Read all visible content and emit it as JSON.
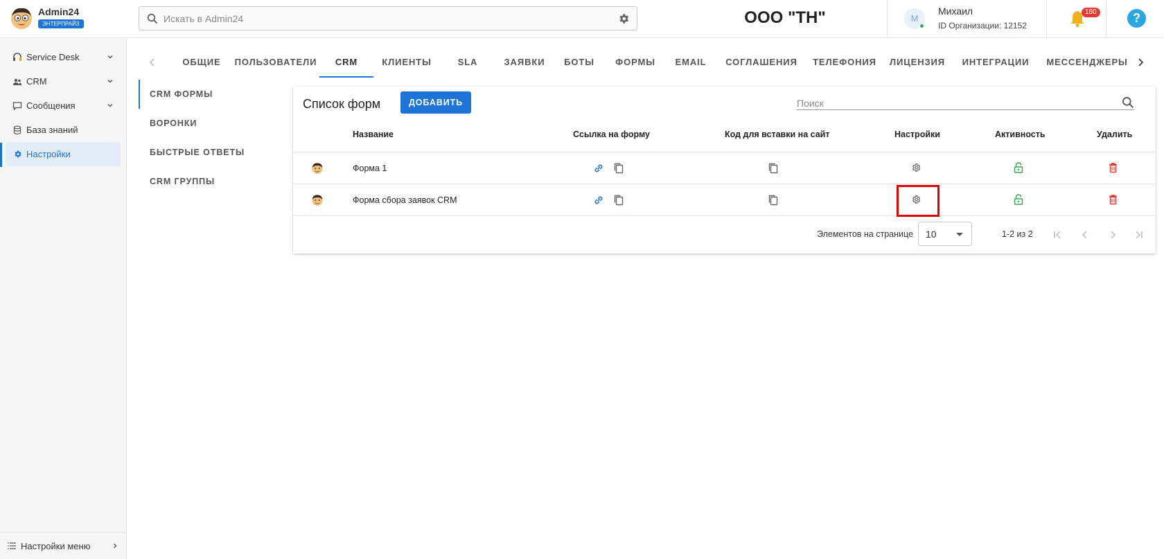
{
  "brand": {
    "name": "Admin24",
    "badge": "ЭНТЕРПРАЙЗ"
  },
  "sidebar": {
    "items": [
      {
        "label": "Service Desk",
        "icon": "headset-icon",
        "expandable": true
      },
      {
        "label": "CRM",
        "icon": "people-icon",
        "expandable": true
      },
      {
        "label": "Сообщения",
        "icon": "chat-icon",
        "expandable": true
      },
      {
        "label": "База знаний",
        "icon": "database-icon",
        "expandable": false
      },
      {
        "label": "Настройки",
        "icon": "gear-icon",
        "expandable": false,
        "active": true
      }
    ],
    "footer": "Настройки меню"
  },
  "topbar": {
    "search_placeholder": "Искать в Admin24",
    "org_name": "ООО \"ТН\"",
    "user": {
      "initial": "М",
      "name": "Михаил",
      "org_id": "ID Организации: 12152"
    },
    "notifications": "180",
    "help": "?"
  },
  "tabs": [
    "ОБЩИЕ",
    "ПОЛЬЗОВАТЕЛИ",
    "CRM",
    "КЛИЕНТЫ",
    "SLA",
    "ЗАЯВКИ",
    "БОТЫ",
    "ФОРМЫ",
    "EMAIL",
    "СОГЛАШЕНИЯ",
    "ТЕЛЕФОНИЯ",
    "ЛИЦЕНЗИЯ",
    "ИНТЕГРАЦИИ",
    "МЕССЕНДЖЕРЫ"
  ],
  "active_tab": "CRM",
  "submenu": [
    "CRM ФОРМЫ",
    "ВОРОНКИ",
    "БЫСТРЫЕ ОТВЕТЫ",
    "CRM ГРУППЫ"
  ],
  "card": {
    "title": "Список форм",
    "add_label": "ДОБАВИТЬ",
    "search_placeholder": "Поиск",
    "columns": {
      "name": "Название",
      "link": "Ссылка на форму",
      "code": "Код для вставки на сайт",
      "settings": "Настройки",
      "activity": "Активность",
      "delete": "Удалить"
    },
    "rows": [
      {
        "name": "Форма 1"
      },
      {
        "name": "Форма сбора заявок CRM"
      }
    ],
    "pager": {
      "label": "Элементов на странице",
      "per_page": "10",
      "range": "1-2 из 2"
    }
  },
  "colors": {
    "accent": "#1e73d6",
    "active_green": "#35a853",
    "delete_red": "#e53935",
    "highlight": "#e00000"
  }
}
